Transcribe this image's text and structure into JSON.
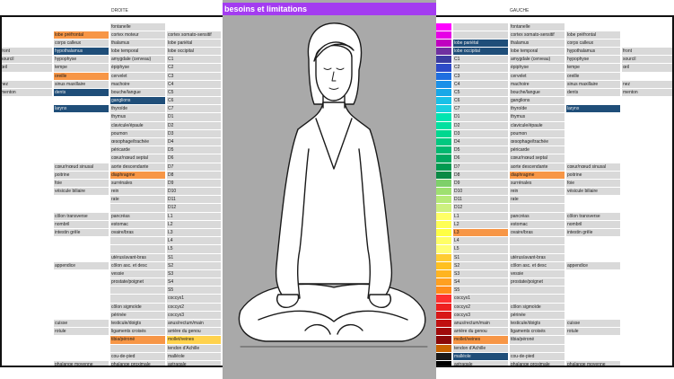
{
  "banner": {
    "title": "besoins et limitations",
    "color": "#a33cf0"
  },
  "left": {
    "header": "DROITE",
    "rows": [
      {
        "a": "",
        "b": "",
        "c": "fontanelle",
        "d": "",
        "bc": "",
        "cc": "",
        "dc": ""
      },
      {
        "a": "",
        "b": "lobe préfrontal",
        "c": "cortex moteur",
        "d": "cortex somato-sensitif",
        "bc": "orange",
        "cc": "",
        "dc": ""
      },
      {
        "a": "",
        "b": "corps calleux",
        "c": "thalamus",
        "d": "lobe pariétal",
        "bc": "",
        "cc": "",
        "dc": ""
      },
      {
        "a": "front",
        "b": "hypothalamus",
        "c": "lobe temporal",
        "d": "lobe occipital",
        "bc": "navy",
        "cc": "",
        "dc": ""
      },
      {
        "a": "sourcil",
        "b": "hypophyse",
        "c": "amygdale (cerveau)",
        "d": "C1",
        "bc": "",
        "cc": "",
        "dc": ""
      },
      {
        "a": "œil",
        "b": "tempe",
        "c": "épiphyse",
        "d": "C2",
        "bc": "",
        "cc": "",
        "dc": ""
      },
      {
        "a": "",
        "b": "oreille",
        "c": "cervelet",
        "d": "C3",
        "bc": "orange",
        "cc": "",
        "dc": ""
      },
      {
        "a": "nez",
        "b": "sinus maxillaire",
        "c": "machoire",
        "d": "C4",
        "bc": "",
        "cc": "",
        "dc": ""
      },
      {
        "a": "menton",
        "b": "dents",
        "c": "bouche/langue",
        "d": "C5",
        "bc": "navy",
        "cc": "",
        "dc": ""
      },
      {
        "a": "",
        "b": "",
        "c": "ganglions",
        "d": "C6",
        "bc": "",
        "cc": "navy",
        "dc": ""
      },
      {
        "a": "",
        "b": "larynx",
        "c": "thyroïde",
        "d": "C7",
        "bc": "navy",
        "cc": "",
        "dc": ""
      },
      {
        "a": "",
        "b": "",
        "c": "thymus",
        "d": "D1",
        "bc": "",
        "cc": "",
        "dc": ""
      },
      {
        "a": "",
        "b": "",
        "c": "clavicule/épaule",
        "d": "D2",
        "bc": "",
        "cc": "",
        "dc": ""
      },
      {
        "a": "",
        "b": "",
        "c": "poumon",
        "d": "D3",
        "bc": "",
        "cc": "",
        "dc": ""
      },
      {
        "a": "",
        "b": "",
        "c": "œsophage/trachée",
        "d": "D4",
        "bc": "",
        "cc": "",
        "dc": ""
      },
      {
        "a": "",
        "b": "",
        "c": "péricarde",
        "d": "D5",
        "bc": "",
        "cc": "",
        "dc": ""
      },
      {
        "a": "",
        "b": "",
        "c": "cœur/nœud septal",
        "d": "D6",
        "bc": "",
        "cc": "",
        "dc": ""
      },
      {
        "a": "",
        "b": "cœur/nœud sinusal",
        "c": "aorte descendante",
        "d": "D7",
        "bc": "",
        "cc": "",
        "dc": ""
      },
      {
        "a": "",
        "b": "poitrine",
        "c": "diaphragme",
        "d": "D8",
        "bc": "",
        "cc": "orange",
        "dc": ""
      },
      {
        "a": "",
        "b": "foie",
        "c": "surrénales",
        "d": "D9",
        "bc": "",
        "cc": "",
        "dc": ""
      },
      {
        "a": "",
        "b": "vésicule biliaire",
        "c": "rein",
        "d": "D10",
        "bc": "",
        "cc": "",
        "dc": ""
      },
      {
        "a": "",
        "b": "",
        "c": "rate",
        "d": "D11",
        "bc": "",
        "cc": "",
        "dc": ""
      },
      {
        "a": "",
        "b": "",
        "c": "",
        "d": "D12",
        "bc": "",
        "cc": "",
        "dc": ""
      },
      {
        "a": "",
        "b": "côlon transverse",
        "c": "pancréas",
        "d": "L1",
        "bc": "",
        "cc": "",
        "dc": ""
      },
      {
        "a": "",
        "b": "nombril",
        "c": "estomac",
        "d": "L2",
        "bc": "",
        "cc": "",
        "dc": ""
      },
      {
        "a": "",
        "b": "intestin grêle",
        "c": "ovaire/bras",
        "d": "L3",
        "bc": "",
        "cc": "",
        "dc": ""
      },
      {
        "a": "",
        "b": "",
        "c": "",
        "d": "L4",
        "bc": "",
        "cc": "",
        "dc": ""
      },
      {
        "a": "",
        "b": "",
        "c": "",
        "d": "L5",
        "bc": "",
        "cc": "",
        "dc": ""
      },
      {
        "a": "",
        "b": "",
        "c": "utérus/avant-bras",
        "d": "S1",
        "bc": "",
        "cc": "",
        "dc": ""
      },
      {
        "a": "",
        "b": "appendice",
        "c": "côlon asc. et desc",
        "d": "S2",
        "bc": "",
        "cc": "",
        "dc": ""
      },
      {
        "a": "",
        "b": "",
        "c": "vessie",
        "d": "S3",
        "bc": "",
        "cc": "",
        "dc": ""
      },
      {
        "a": "",
        "b": "",
        "c": "prostate/poignet",
        "d": "S4",
        "bc": "",
        "cc": "",
        "dc": ""
      },
      {
        "a": "",
        "b": "",
        "c": "",
        "d": "S5",
        "bc": "",
        "cc": "",
        "dc": ""
      },
      {
        "a": "",
        "b": "",
        "c": "",
        "d": "coccyx1",
        "bc": "",
        "cc": "",
        "dc": ""
      },
      {
        "a": "",
        "b": "",
        "c": "côlon sigmoïde",
        "d": "coccyx2",
        "bc": "",
        "cc": "",
        "dc": ""
      },
      {
        "a": "",
        "b": "",
        "c": "périnée",
        "d": "coccyx3",
        "bc": "",
        "cc": "",
        "dc": ""
      },
      {
        "a": "",
        "b": "cuisse",
        "c": "testicule/doigts",
        "d": "anus/rectum/main",
        "bc": "",
        "cc": "",
        "dc": ""
      },
      {
        "a": "",
        "b": "rotule",
        "c": "ligaments croisés",
        "d": "arrière du genou",
        "bc": "",
        "cc": "",
        "dc": ""
      },
      {
        "a": "",
        "b": "",
        "c": "tibia/péroné",
        "d": "mollet/veines",
        "bc": "",
        "cc": "orange",
        "dc": "yellowc"
      },
      {
        "a": "",
        "b": "",
        "c": "",
        "d": "tendon d'Achille",
        "bc": "",
        "cc": "",
        "dc": ""
      },
      {
        "a": "",
        "b": "",
        "c": "cou-de-pied",
        "d": "malléole",
        "bc": "",
        "cc": "",
        "dc": ""
      },
      {
        "a": "",
        "b": "phalange moyenne",
        "c": "phalange proximale",
        "d": "astragale",
        "bc": "",
        "cc": "",
        "dc": ""
      },
      {
        "a": "extrémité du pied",
        "b": "phalange distale",
        "c": "voûte plantaire",
        "d": "talon",
        "bc": "",
        "cc": "",
        "dc": ""
      }
    ]
  },
  "right": {
    "header": "GAUCHE",
    "rows": [
      {
        "sw": "#ff00ff",
        "b": "",
        "c": "fontanelle",
        "d": "",
        "e": "",
        "bc": "",
        "cc": "",
        "dc": ""
      },
      {
        "sw": "#e600e6",
        "b": "",
        "c": "cortex somato-sensitif",
        "d": "lobe préfrontal",
        "e": "",
        "bc": "",
        "cc": "",
        "dc": ""
      },
      {
        "sw": "#c000c0",
        "b": "lobe pariétal",
        "c": "thalamus",
        "d": "corps calleux",
        "e": "",
        "bc": "navy",
        "cc": "",
        "dc": ""
      },
      {
        "sw": "#7030a0",
        "b": "lobe occipital",
        "c": "lobe temporal",
        "d": "hypothalamus",
        "e": "front",
        "bc": "navy",
        "cc": "",
        "dc": ""
      },
      {
        "sw": "#3c3ca0",
        "b": "C1",
        "c": "amygdale (cerveau)",
        "d": "hypophyse",
        "e": "sourcil",
        "bc": "",
        "cc": "",
        "dc": ""
      },
      {
        "sw": "#2e4bc8",
        "b": "C2",
        "c": "épiphyse",
        "d": "tempe",
        "e": "œil",
        "bc": "",
        "cc": "",
        "dc": ""
      },
      {
        "sw": "#1f6fe0",
        "b": "C3",
        "c": "cervelet",
        "d": "oreille",
        "e": "",
        "bc": "",
        "cc": "",
        "dc": ""
      },
      {
        "sw": "#1a90e8",
        "b": "C4",
        "c": "machoire",
        "d": "sinus maxillaire",
        "e": "nez",
        "bc": "",
        "cc": "",
        "dc": ""
      },
      {
        "sw": "#18a8e8",
        "b": "C5",
        "c": "bouche/langue",
        "d": "dents",
        "e": "menton",
        "bc": "",
        "cc": "",
        "dc": ""
      },
      {
        "sw": "#19c0e8",
        "b": "C6",
        "c": "ganglions",
        "d": "",
        "e": "",
        "bc": "",
        "cc": "",
        "dc": ""
      },
      {
        "sw": "#1ad0e0",
        "b": "C7",
        "c": "thyroïde",
        "d": "larynx",
        "e": "",
        "bc": "",
        "cc": "",
        "dc": "navy"
      },
      {
        "sw": "#00e5b0",
        "b": "D1",
        "c": "thymus",
        "d": "",
        "e": "",
        "bc": "",
        "cc": "",
        "dc": ""
      },
      {
        "sw": "#00e0a0",
        "b": "D2",
        "c": "clavicule/épaule",
        "d": "",
        "e": "",
        "bc": "",
        "cc": "",
        "dc": ""
      },
      {
        "sw": "#00d890",
        "b": "D3",
        "c": "poumon",
        "d": "",
        "e": "",
        "bc": "",
        "cc": "",
        "dc": ""
      },
      {
        "sw": "#00c880",
        "b": "D4",
        "c": "œsophage/trachée",
        "d": "",
        "e": "",
        "bc": "",
        "cc": "",
        "dc": ""
      },
      {
        "sw": "#00b870",
        "b": "D5",
        "c": "péricarde",
        "d": "",
        "e": "",
        "bc": "",
        "cc": "",
        "dc": ""
      },
      {
        "sw": "#00a860",
        "b": "D6",
        "c": "cœur/nœud septal",
        "d": "",
        "e": "",
        "bc": "",
        "cc": "",
        "dc": ""
      },
      {
        "sw": "#009a50",
        "b": "D7",
        "c": "aorte descendante",
        "d": "cœur/nœud sinusal",
        "e": "",
        "bc": "",
        "cc": "",
        "dc": ""
      },
      {
        "sw": "#0a8a45",
        "b": "D8",
        "c": "diaphragme",
        "d": "poitrine",
        "e": "",
        "bc": "",
        "cc": "orange",
        "dc": ""
      },
      {
        "sw": "#7ed06a",
        "b": "D9",
        "c": "surrénales",
        "d": "foie",
        "e": "",
        "bc": "",
        "cc": "",
        "dc": ""
      },
      {
        "sw": "#9ee070",
        "b": "D10",
        "c": "rein",
        "d": "vésicule biliaire",
        "e": "",
        "bc": "",
        "cc": "",
        "dc": ""
      },
      {
        "sw": "#b6ea78",
        "b": "D11",
        "c": "rate",
        "d": "",
        "e": "",
        "bc": "",
        "cc": "",
        "dc": ""
      },
      {
        "sw": "#cdf080",
        "b": "D12",
        "c": "",
        "d": "",
        "e": "",
        "bc": "",
        "cc": "",
        "dc": ""
      },
      {
        "sw": "#ffff66",
        "b": "L1",
        "c": "pancréas",
        "d": "côlon transverse",
        "e": "",
        "bc": "",
        "cc": "",
        "dc": ""
      },
      {
        "sw": "#ffff55",
        "b": "L2",
        "c": "estomac",
        "d": "nombril",
        "e": "",
        "bc": "",
        "cc": "",
        "dc": ""
      },
      {
        "sw": "#ffff44",
        "b": "L3",
        "c": "ovaire/bras",
        "d": "intestin grêle",
        "e": "",
        "bc": "orange",
        "cc": "",
        "dc": ""
      },
      {
        "sw": "#ffff66",
        "b": "L4",
        "c": "",
        "d": "",
        "e": "",
        "bc": "",
        "cc": "",
        "dc": ""
      },
      {
        "sw": "#ffff77",
        "b": "L5",
        "c": "",
        "d": "",
        "e": "",
        "bc": "",
        "cc": "",
        "dc": ""
      },
      {
        "sw": "#ffcc33",
        "b": "S1",
        "c": "utérus/avant-bras",
        "d": "",
        "e": "",
        "bc": "",
        "cc": "",
        "dc": ""
      },
      {
        "sw": "#ffc020",
        "b": "S2",
        "c": "côlon asc. et desc",
        "d": "appendice",
        "e": "",
        "bc": "",
        "cc": "",
        "dc": ""
      },
      {
        "sw": "#ffb420",
        "b": "S3",
        "c": "vessie",
        "d": "",
        "e": "",
        "bc": "",
        "cc": "",
        "dc": ""
      },
      {
        "sw": "#ffa020",
        "b": "S4",
        "c": "prostate/poignet",
        "d": "",
        "e": "",
        "bc": "",
        "cc": "",
        "dc": ""
      },
      {
        "sw": "#ff8c1a",
        "b": "S5",
        "c": "",
        "d": "",
        "e": "",
        "bc": "",
        "cc": "",
        "dc": ""
      },
      {
        "sw": "#ff3030",
        "b": "coccyx1",
        "c": "",
        "d": "",
        "e": "",
        "bc": "",
        "cc": "",
        "dc": ""
      },
      {
        "sw": "#ee2020",
        "b": "coccyx2",
        "c": "côlon sigmoïde",
        "d": "",
        "e": "",
        "bc": "",
        "cc": "",
        "dc": ""
      },
      {
        "sw": "#d81818",
        "b": "coccyx3",
        "c": "périnée",
        "d": "",
        "e": "",
        "bc": "",
        "cc": "",
        "dc": ""
      },
      {
        "sw": "#c01010",
        "b": "anus/rectum/main",
        "c": "testicule/doigts",
        "d": "cuisse",
        "e": "",
        "bc": "",
        "cc": "",
        "dc": ""
      },
      {
        "sw": "#a00a0a",
        "b": "arrière du genou",
        "c": "ligaments croisés",
        "d": "rotule",
        "e": "",
        "bc": "",
        "cc": "",
        "dc": ""
      },
      {
        "sw": "#8a0808",
        "b": "mollet/veines",
        "c": "tibia/péroné",
        "d": "",
        "e": "",
        "bc": "orange",
        "cc": "",
        "dc": ""
      },
      {
        "sw": "#c86400",
        "b": "tendon d'Achille",
        "c": "",
        "d": "",
        "e": "",
        "bc": "",
        "cc": "",
        "dc": ""
      },
      {
        "sw": "#1a1a1a",
        "b": "malléole",
        "c": "cou-de-pied",
        "d": "",
        "e": "",
        "bc": "navy",
        "cc": "",
        "dc": ""
      },
      {
        "sw": "#000000",
        "b": "astragale",
        "c": "phalange proximale",
        "d": "phalange moyenne",
        "e": "",
        "bc": "",
        "cc": "",
        "dc": ""
      },
      {
        "sw": "#000000",
        "b": "talon",
        "c": "voûte plantaire",
        "d": "phalange distale",
        "e": "extrémité du pied",
        "bc": "",
        "cc": "",
        "dc": ""
      }
    ]
  }
}
